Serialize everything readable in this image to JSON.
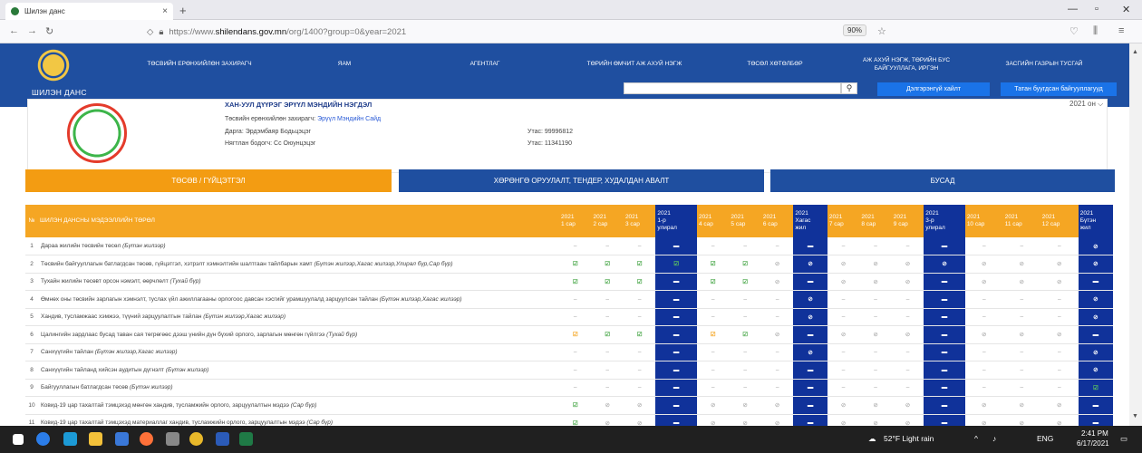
{
  "browser": {
    "tab_title": "Шилэн данс",
    "tab_close": "×",
    "new_tab": "+",
    "url_prefix": "https://www.",
    "url_domain": "shilendans.gov.mn",
    "url_path": "/org/1400?group=0&year=2021",
    "zoom": "90%",
    "min": "—",
    "max": "▫",
    "close": "✕"
  },
  "header": {
    "logo_label": "ШИЛЭН ДАНС",
    "menu": [
      "ТӨСВИЙН ЕРӨНХИЙЛӨН ЗАХИРАГЧ",
      "ЯАМ",
      "АГЕНТЛАГ",
      "ТӨРИЙН ӨМЧИТ АЖ АХУЙ НЭГЖ",
      "ТӨСӨЛ ХӨТӨЛБӨР",
      "АЖ АХУЙ НЭГЖ, ТӨРИЙН БУС\nБАЙГУУЛЛАГА, ИРГЭН",
      "ЗАСГИЙН ГАЗРЫН ТУСГАЙ"
    ],
    "advanced_search": "Дэлгэрэнгүй хайлт",
    "download_orgs": "Татан буугдсан байгууллагууд",
    "search_icon": "search-icon"
  },
  "org": {
    "name": "ХАН-УУЛ ДҮҮРЭГ ЭРҮҮЛ МЭНДИЙН НЭГДЭЛ",
    "budget_label": "Төсвийн ерөнхийлөн захирагч:",
    "budget_link": "Эрүүл Мэндийн Сайд",
    "director": "Дарга: Эрдэмбаяр Бодьцэцэг",
    "director_phone": "Утас: 99996812",
    "accountant": "Нягтлан бодогч: Сс Оюунцэцэг",
    "accountant_phone": "Утас: 11341190",
    "year": "2021 он",
    "year_chevron": "⌵"
  },
  "sections": [
    "ТӨСӨВ / ГҮЙЦЭТГЭЛ",
    "ХӨРӨНГӨ ОРУУЛАЛТ, ТЕНДЕР, ХУДАЛДАН АВАЛТ",
    "БУСАД"
  ],
  "table": {
    "headers": [
      "№",
      "ШИЛЭН ДАНСНЫ МЭДЭЭЛЛИЙН ТӨРӨЛ",
      "2021\n1 сар",
      "2021\n2 сар",
      "2021\n3 сар",
      "2021\n1-р\nулирал",
      "2021\n4 сар",
      "2021\n5 сар",
      "2021\n6 сар",
      "2021\nХагас\nжил",
      "2021\n7 сар",
      "2021\n8 сар",
      "2021\n9 сар",
      "2021\n3-р\nулирал",
      "2021\n10 сар",
      "2021\n11 сар",
      "2021\n12 сар",
      "2021\nБүтэн\nжил"
    ],
    "rows": [
      {
        "n": "1",
        "t": "Дараа жилийн төсвийн төсөл",
        "p": "(Бүтэн жилээр)",
        "c": [
          "–",
          "–",
          "–",
          "B-",
          "–",
          "–",
          "–",
          "B-",
          "–",
          "–",
          "–",
          "B-",
          "–",
          "–",
          "–",
          "BO"
        ]
      },
      {
        "n": "2",
        "t": "Төсвийн байгууллагын батлагдсан төсөв, гүйцэтгэл, хэтрэлт хэмнэлтийн шалтгаан тайлбарын хамт",
        "p": "(Бүтэн жилээр,Хагас жилээр,Улирал бүр,Сар бүр)",
        "c": [
          "V",
          "V",
          "V",
          "BV",
          "V",
          "V",
          "o",
          "BO",
          "o",
          "o",
          "o",
          "BO",
          "o",
          "o",
          "o",
          "BO"
        ]
      },
      {
        "n": "3",
        "t": "Тухайн жилийн төсөвт орсон нэмэлт, өөрчлөлт",
        "p": "(Тухай бүр)",
        "c": [
          "V",
          "V",
          "V",
          "B-",
          "V",
          "V",
          "o",
          "B-",
          "o",
          "o",
          "o",
          "B-",
          "o",
          "o",
          "o",
          "B-"
        ]
      },
      {
        "n": "4",
        "t": "Өмнөх оны төсвийн зарлагын хэмнэлт, туслах үйл ажиллагааны орлогоос давсан хэсгийг урамшуулалд зарцуулсан тайлан",
        "p": "(Бүтэн жилээр,Хагас жилээр)",
        "c": [
          "–",
          "–",
          "–",
          "B-",
          "–",
          "–",
          "–",
          "BO",
          "–",
          "–",
          "–",
          "B-",
          "–",
          "–",
          "–",
          "BO"
        ]
      },
      {
        "n": "5",
        "t": "Хандив, тусламжаас хэмжээ, түүний зарцуулалтын тайлан",
        "p": "(Бүтэн жилээр,Хагас жилээр)",
        "c": [
          "–",
          "–",
          "–",
          "B-",
          "–",
          "–",
          "–",
          "BO",
          "–",
          "–",
          "–",
          "B-",
          "–",
          "–",
          "–",
          "BO"
        ]
      },
      {
        "n": "6",
        "t": "Цалингийн зардлаас бусад таван сая төгрөгөөс дээш үнийн дүн бүхий орлого, зарлагын мөнгөн гүйлгээ",
        "p": "(Тухай бүр)",
        "c": [
          "W",
          "V",
          "V",
          "B-",
          "W",
          "V",
          "o",
          "B-",
          "o",
          "o",
          "o",
          "B-",
          "o",
          "o",
          "o",
          "B-"
        ]
      },
      {
        "n": "7",
        "t": "Санхүүгийн тайлан",
        "p": "(Бүтэн жилээр,Хагас жилээр)",
        "c": [
          "–",
          "–",
          "–",
          "B-",
          "–",
          "–",
          "–",
          "BO",
          "–",
          "–",
          "–",
          "B-",
          "–",
          "–",
          "–",
          "BO"
        ]
      },
      {
        "n": "8",
        "t": "Санхүүгийн тайланд хийсэн аудитын дүгнэлт",
        "p": "(Бүтэн жилээр)",
        "c": [
          "–",
          "–",
          "–",
          "B-",
          "–",
          "–",
          "–",
          "B-",
          "–",
          "–",
          "–",
          "B-",
          "–",
          "–",
          "–",
          "BO"
        ]
      },
      {
        "n": "9",
        "t": "Байгууллагын батлагдсан төсөв",
        "p": "(Бүтэн жилээр)",
        "c": [
          "–",
          "–",
          "–",
          "B-",
          "–",
          "–",
          "–",
          "B-",
          "–",
          "–",
          "–",
          "B-",
          "–",
          "–",
          "–",
          "BV"
        ]
      },
      {
        "n": "10",
        "t": "Ковид-19 цар тахалтай тэмцэхэд мөнгөн хандив, тусламжийн орлого, зарцуулалтын мэдээ",
        "p": "(Сар бүр)",
        "c": [
          "V",
          "o",
          "o",
          "B-",
          "o",
          "o",
          "o",
          "B-",
          "o",
          "o",
          "o",
          "B-",
          "o",
          "o",
          "o",
          "B-"
        ]
      },
      {
        "n": "11",
        "t": "Ковид-19 цар тахалтай тэмцэхэд материаллаг хандив, тусламжийн орлого, зарцуулалтын мэдээ",
        "p": "(Сар бүр)",
        "c": [
          "V",
          "o",
          "o",
          "B-",
          "o",
          "o",
          "o",
          "B-",
          "o",
          "o",
          "o",
          "B-",
          "o",
          "o",
          "o",
          "B-"
        ]
      }
    ]
  },
  "taskbar": {
    "weather": "52°F  Light rain",
    "lang": "ENG",
    "time": "2:41 PM",
    "date": "6/17/2021"
  }
}
